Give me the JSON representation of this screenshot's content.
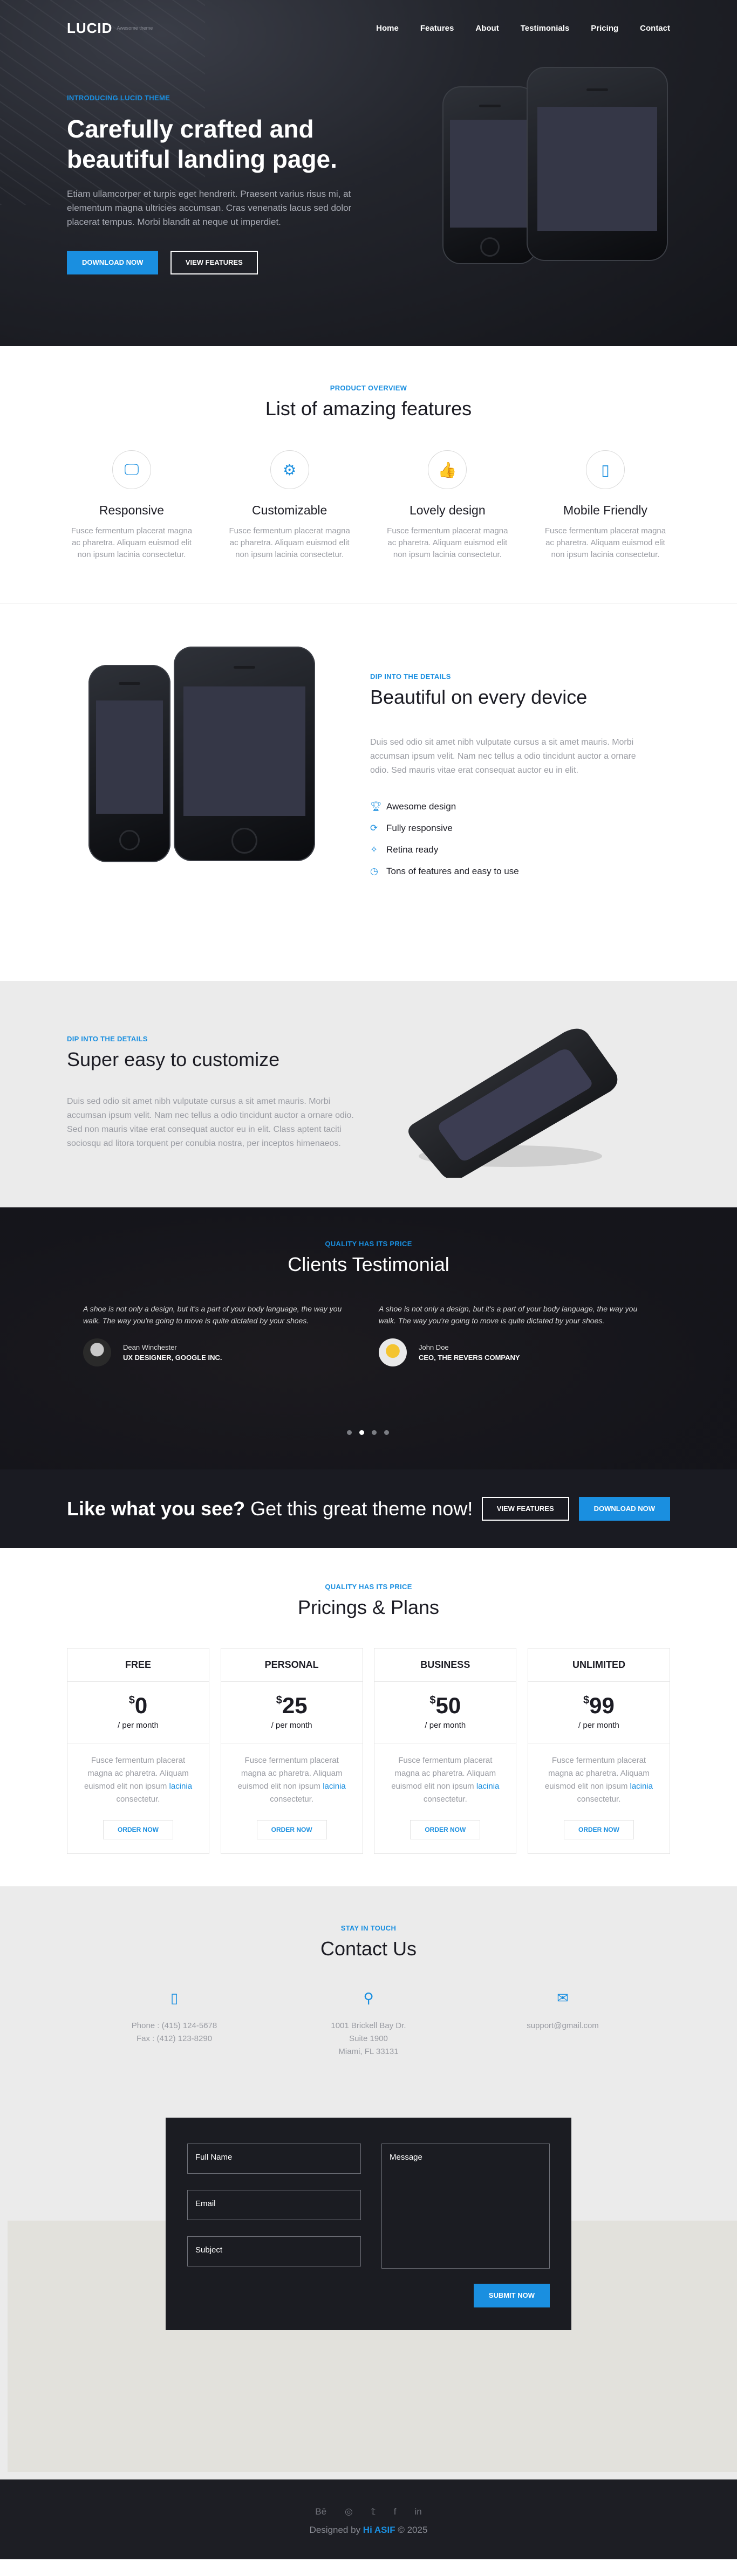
{
  "header": {
    "logo": "LUCID",
    "tagline": "Awesome theme",
    "menu": [
      "Home",
      "Features",
      "About",
      "Testimonials",
      "Pricing",
      "Contact"
    ]
  },
  "hero": {
    "kicker": "INTRODUCING LUCID THEME",
    "title": "Carefully crafted and beautiful landing page.",
    "text": "Etiam ullamcorper et turpis eget hendrerit. Praesent varius risus mi, at elementum magna ultricies accumsan. Cras venenatis lacus sed dolor placerat tempus. Morbi blandit at neque ut imperdiet.",
    "primary_btn": "DOWNLOAD NOW",
    "secondary_btn": "VIEW FEATURES"
  },
  "features": {
    "kicker": "PRODUCT OVERVIEW",
    "title": "List of amazing features",
    "items": [
      {
        "icon": "monitor-icon",
        "title": "Responsive",
        "text": "Fusce fermentum placerat magna ac pharetra. Aliquam euismod elit non ipsum lacinia consectetur."
      },
      {
        "icon": "gear-icon",
        "title": "Customizable",
        "text": "Fusce fermentum placerat magna ac pharetra. Aliquam euismod elit non ipsum lacinia consectetur."
      },
      {
        "icon": "thumbs-up-icon",
        "title": "Lovely design",
        "text": "Fusce fermentum placerat magna ac pharetra. Aliquam euismod elit non ipsum lacinia consectetur."
      },
      {
        "icon": "mobile-icon",
        "title": "Mobile Friendly",
        "text": "Fusce fermentum placerat magna ac pharetra. Aliquam euismod elit non ipsum lacinia consectetur."
      }
    ]
  },
  "device": {
    "kicker": "DIP INTO THE DETAILS",
    "title": "Beautiful on every device",
    "text": "Duis sed odio sit amet nibh vulputate cursus a sit amet mauris. Morbi accumsan ipsum velit. Nam nec tellus a odio tincidunt auctor a ornare odio. Sed mauris vitae erat consequat auctor eu in elit.",
    "list": [
      "Awesome design",
      "Fully responsive",
      "Retina ready",
      "Tons of features and easy to use"
    ]
  },
  "customize": {
    "kicker": "DIP INTO THE DETAILS",
    "title": "Super easy to customize",
    "text": "Duis sed odio sit amet nibh vulputate cursus a sit amet mauris. Morbi accumsan ipsum velit. Nam nec tellus a odio tincidunt auctor a ornare odio. Sed non mauris vitae erat consequat auctor eu in elit. Class aptent taciti sociosqu ad litora torquent per conubia nostra, per inceptos himenaeos."
  },
  "testimonials": {
    "kicker": "QUALITY HAS ITS PRICE",
    "title": "Clients Testimonial",
    "items": [
      {
        "quote": "A shoe is not only a design, but it's a part of your body language, the way you walk. The way you're going to move is quite dictated by your shoes.",
        "name": "Dean Winchester",
        "role": "UX DESIGNER, GOOGLE INC."
      },
      {
        "quote": "A shoe is not only a design, but it's a part of your body language, the way you walk. The way you're going to move is quite dictated by your shoes.",
        "name": "John Doe",
        "role": "CEO, THE REVERS COMPANY"
      }
    ]
  },
  "cta": {
    "title_bold": "Like what you see?",
    "title_light": " Get this great theme now!",
    "btn1": "VIEW FEATURES",
    "btn2": "DOWNLOAD NOW"
  },
  "pricing": {
    "kicker": "QUALITY HAS ITS PRICE",
    "title": "Pricings & Plans",
    "currency": "$",
    "per": "/ per month",
    "order": "ORDER NOW",
    "desc_a": "Fusce fermentum placerat magna ac pharetra. Aliquam euismod elit non ipsum ",
    "desc_link": "lacinia",
    "desc_b": " consectetur.",
    "plans": [
      {
        "name": "FREE",
        "price": "0"
      },
      {
        "name": "PERSONAL",
        "price": "25"
      },
      {
        "name": "BUSINESS",
        "price": "50"
      },
      {
        "name": "UNLIMITED",
        "price": "99"
      }
    ]
  },
  "contact": {
    "kicker": "STAY IN TOUCH",
    "title": "Contact Us",
    "phone1": "Phone : (415) 124-5678",
    "phone2": "Fax : (412) 123-8290",
    "addr1": "1001 Brickell Bay Dr.",
    "addr2": "Suite 1900",
    "addr3": "Miami, FL 33131",
    "email": "support@gmail.com",
    "form": {
      "name": "Full Name",
      "email": "Email",
      "subject": "Subject",
      "message": "Message",
      "submit": "SUBMIT NOW"
    }
  },
  "footer": {
    "socials": [
      "Bē",
      "◎",
      "𝕥",
      "f",
      "in"
    ],
    "copy_a": "Designed by ",
    "copy_author": "Hi ASIF",
    "copy_b": " © 2025"
  }
}
